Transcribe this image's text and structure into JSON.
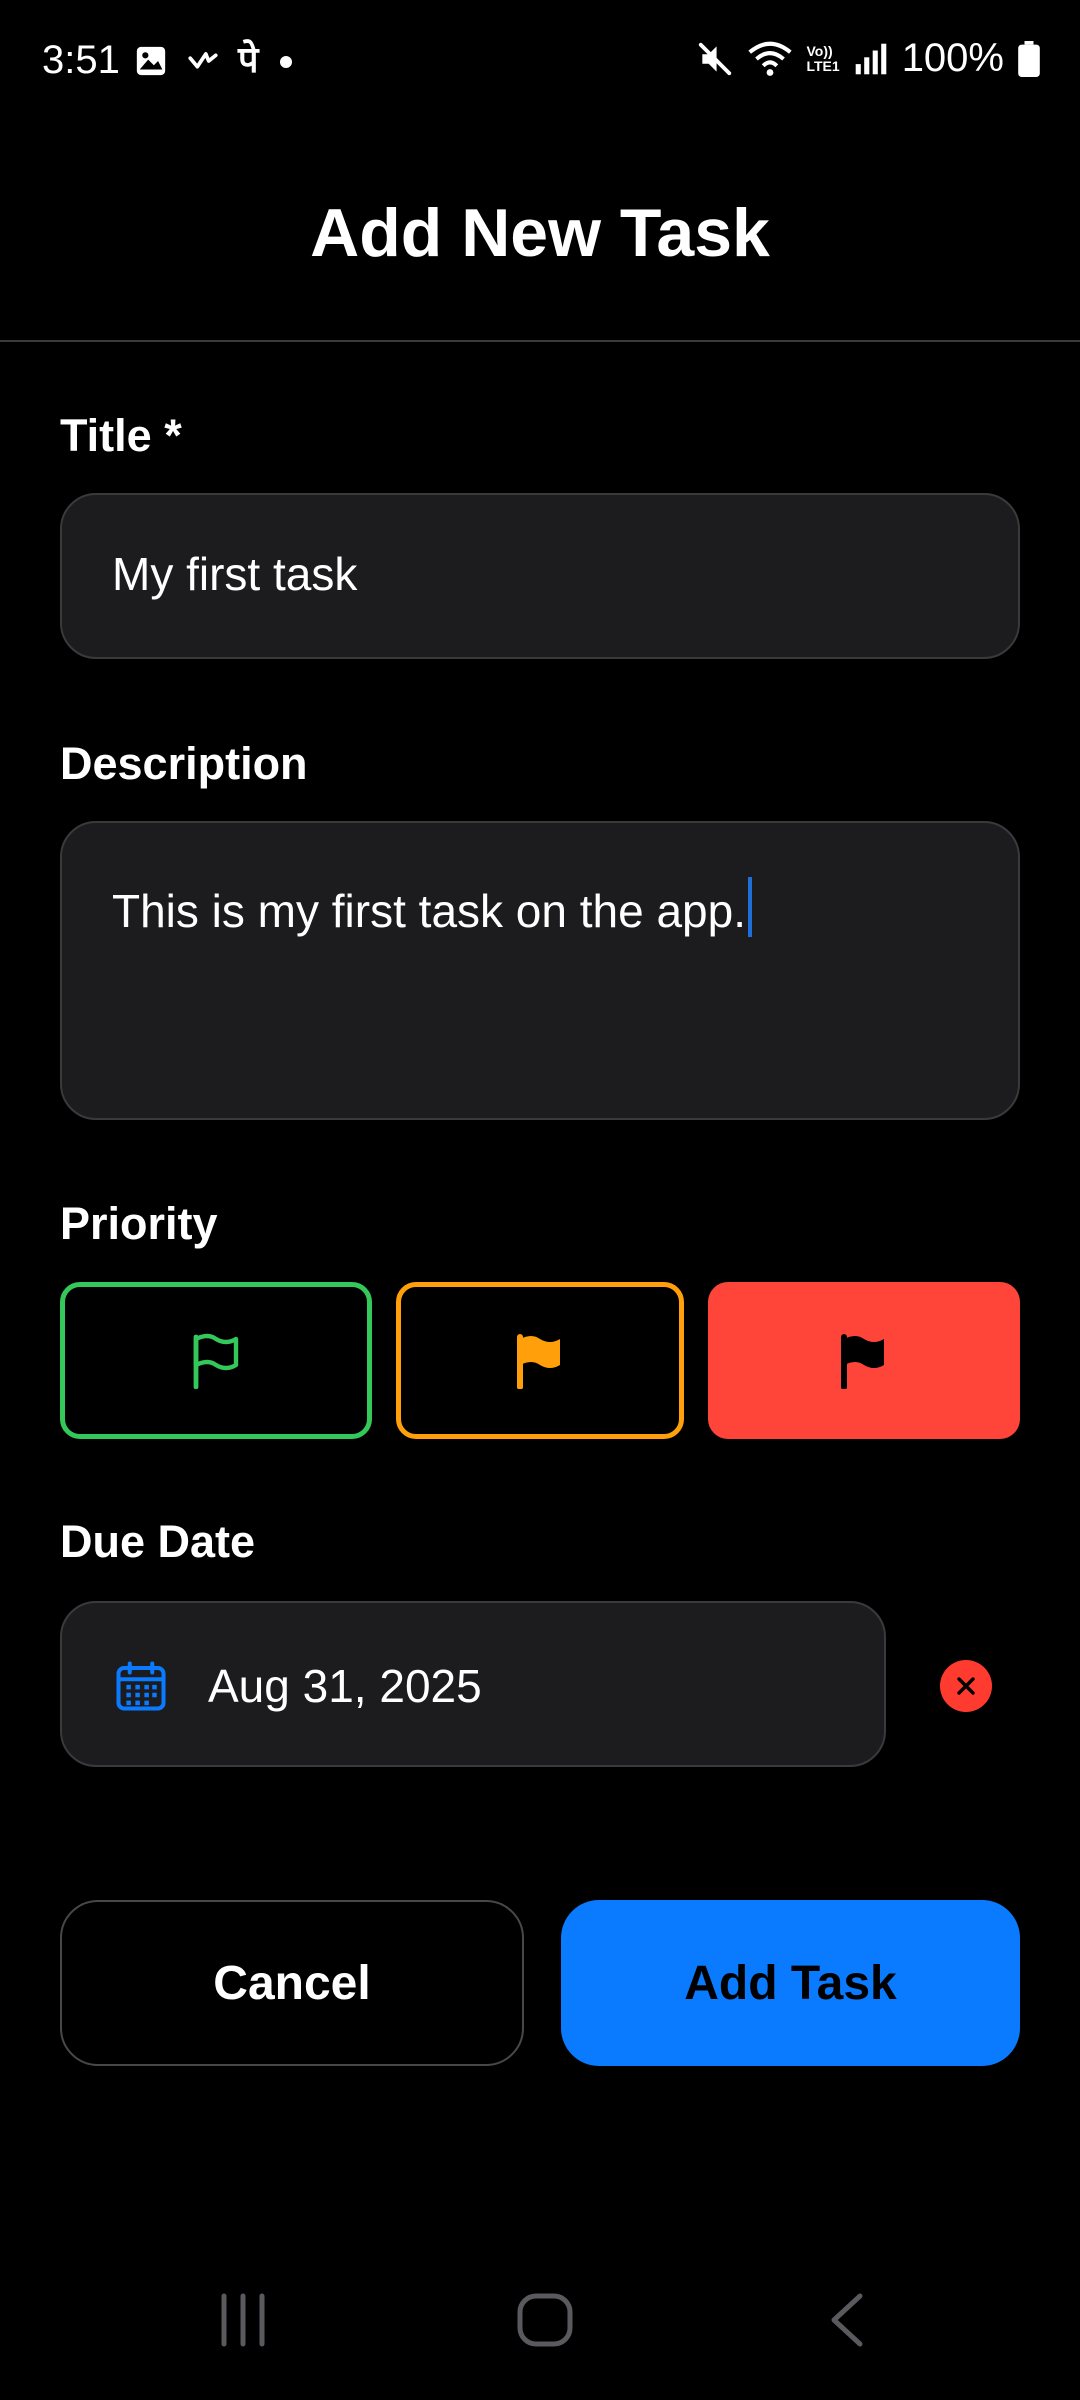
{
  "status_bar": {
    "time": "3:51",
    "left_icons": [
      "image-icon",
      "check-icon",
      "pe-icon",
      "dot-icon"
    ],
    "pe_glyph": "पे",
    "network_label_top": "Vo))",
    "network_label_bottom": "LTE1",
    "battery": "100%"
  },
  "header": {
    "title": "Add New Task"
  },
  "form": {
    "title_label": "Title *",
    "title_value": "My first task",
    "description_label": "Description",
    "description_value": "This is my first task on the app.",
    "priority_label": "Priority",
    "priority_options": [
      {
        "name": "low",
        "color": "#34c759"
      },
      {
        "name": "medium",
        "color": "#ff9f0a"
      },
      {
        "name": "high",
        "color": "#ff453a",
        "selected": true
      }
    ],
    "due_date_label": "Due Date",
    "due_date_value": "Aug 31, 2025"
  },
  "actions": {
    "cancel_label": "Cancel",
    "add_label": "Add Task"
  },
  "colors": {
    "accent": "#0a7aff",
    "background": "#000000",
    "field_bg": "#1c1c1e",
    "danger": "#ff3b30"
  }
}
